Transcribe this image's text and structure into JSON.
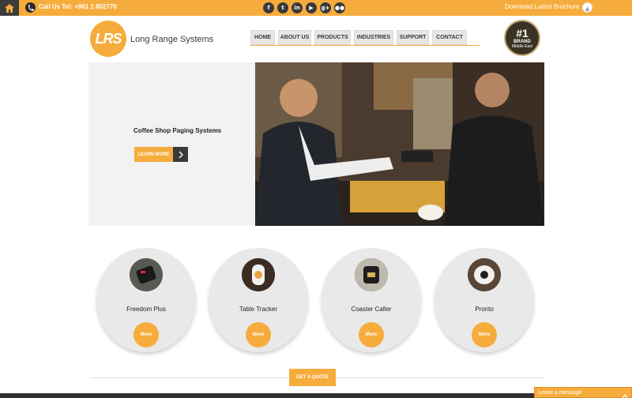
{
  "topbar": {
    "phone_text": "Call Us Tel: +961 1 802770",
    "brochure_text": "Download Latest Brochure",
    "socials": [
      "f",
      "t",
      "in",
      "▶",
      "g+",
      "●●"
    ]
  },
  "header": {
    "logo_mark": "LRS",
    "logo_name": "Long Range Systems",
    "nav": [
      "HOME",
      "ABOUT US",
      "PRODUCTS",
      "INDUSTRIES",
      "SUPPORT",
      "CONTACT"
    ],
    "badge": {
      "rank": "#1",
      "label": "BRAND",
      "sub": "Middle East"
    }
  },
  "hero": {
    "title": "Coffee Shop Paging Systems",
    "button": "LEARN MORE"
  },
  "products": [
    {
      "name": "Freedom Plus",
      "more": "More"
    },
    {
      "name": "Table Tracker",
      "more": "More"
    },
    {
      "name": "Coaster Caller",
      "more": "More"
    },
    {
      "name": "Pronto",
      "more": "More"
    }
  ],
  "quote_button": "GET A QUOTE",
  "chat": {
    "label": "Leave a message"
  },
  "colors": {
    "accent": "#f6ac3c",
    "dark": "#3a3a3a"
  },
  "icons": [
    "home-icon",
    "phone-icon",
    "facebook-icon",
    "twitter-icon",
    "linkedin-icon",
    "youtube-icon",
    "googleplus-icon",
    "flickr-icon",
    "brochure-icon",
    "arrow-right-icon",
    "chevron-up-icon"
  ]
}
